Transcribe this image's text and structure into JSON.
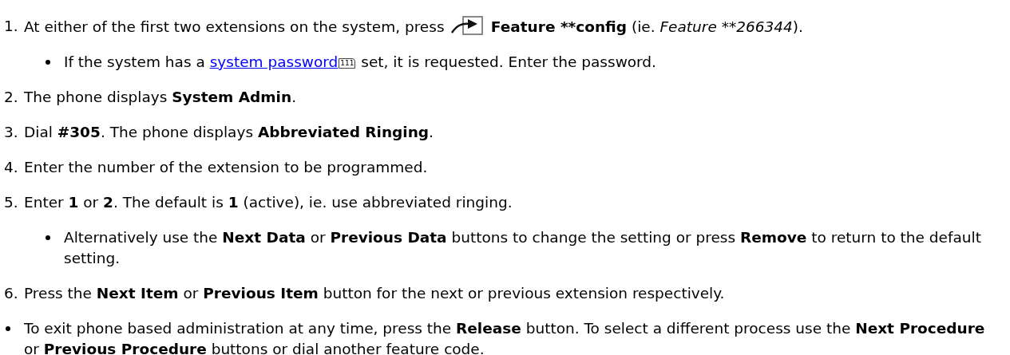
{
  "steps": [
    {
      "number": "1.",
      "parts": [
        {
          "kind": "text",
          "text": "At either of the first two extensions on the system, press "
        },
        {
          "kind": "key-icon"
        },
        {
          "kind": "bold",
          "text": " Feature **config"
        },
        {
          "kind": "text",
          "text": " (ie. "
        },
        {
          "kind": "italic",
          "text": "Feature **266344"
        },
        {
          "kind": "text",
          "text": ")."
        }
      ],
      "notes": [
        {
          "parts": [
            {
              "kind": "text",
              "text": "If the system has a "
            },
            {
              "kind": "link",
              "text": "system password"
            },
            {
              "kind": "ref",
              "text": "111"
            },
            {
              "kind": "text",
              "text": " set, it is requested. Enter the password."
            }
          ]
        }
      ]
    },
    {
      "number": "2.",
      "parts": [
        {
          "kind": "text",
          "text": "The phone displays "
        },
        {
          "kind": "bold",
          "text": "System Admin"
        },
        {
          "kind": "text",
          "text": "."
        }
      ]
    },
    {
      "number": "3.",
      "parts": [
        {
          "kind": "text",
          "text": "Dial "
        },
        {
          "kind": "bold",
          "text": "#305"
        },
        {
          "kind": "text",
          "text": ". The phone displays "
        },
        {
          "kind": "bold",
          "text": "Abbreviated Ringing"
        },
        {
          "kind": "text",
          "text": "."
        }
      ]
    },
    {
      "number": "4.",
      "parts": [
        {
          "kind": "text",
          "text": "Enter the number of the extension to be programmed."
        }
      ]
    },
    {
      "number": "5.",
      "parts": [
        {
          "kind": "text",
          "text": "Enter "
        },
        {
          "kind": "bold",
          "text": "1"
        },
        {
          "kind": "text",
          "text": " or "
        },
        {
          "kind": "bold",
          "text": "2"
        },
        {
          "kind": "text",
          "text": ". The default is "
        },
        {
          "kind": "bold",
          "text": "1"
        },
        {
          "kind": "text",
          "text": " (active), ie. use abbreviated ringing."
        }
      ],
      "notes": [
        {
          "parts": [
            {
              "kind": "text",
              "text": "Alternatively use the "
            },
            {
              "kind": "bold",
              "text": "Next Data"
            },
            {
              "kind": "text",
              "text": " or "
            },
            {
              "kind": "bold",
              "text": "Previous Data"
            },
            {
              "kind": "text",
              "text": " buttons to change the setting or press "
            },
            {
              "kind": "bold",
              "text": "Remove"
            },
            {
              "kind": "text",
              "text": " to return to the default setting."
            }
          ]
        }
      ]
    },
    {
      "number": "6.",
      "parts": [
        {
          "kind": "text",
          "text": "Press the "
        },
        {
          "kind": "bold",
          "text": "Next Item"
        },
        {
          "kind": "text",
          "text": " or "
        },
        {
          "kind": "bold",
          "text": "Previous Item"
        },
        {
          "kind": "text",
          "text": " button for the next or previous extension respectively."
        }
      ]
    }
  ],
  "footer": [
    {
      "parts": [
        {
          "kind": "text",
          "text": "To exit phone based administration at any time, press the "
        },
        {
          "kind": "bold",
          "text": "Release"
        },
        {
          "kind": "text",
          "text": " button. To select a different process use the "
        },
        {
          "kind": "bold",
          "text": "Next Procedure"
        },
        {
          "kind": "text",
          "text": " or "
        },
        {
          "kind": "bold",
          "text": "Previous Procedure"
        },
        {
          "kind": "text",
          "text": " buttons or dial another feature code."
        }
      ]
    }
  ]
}
